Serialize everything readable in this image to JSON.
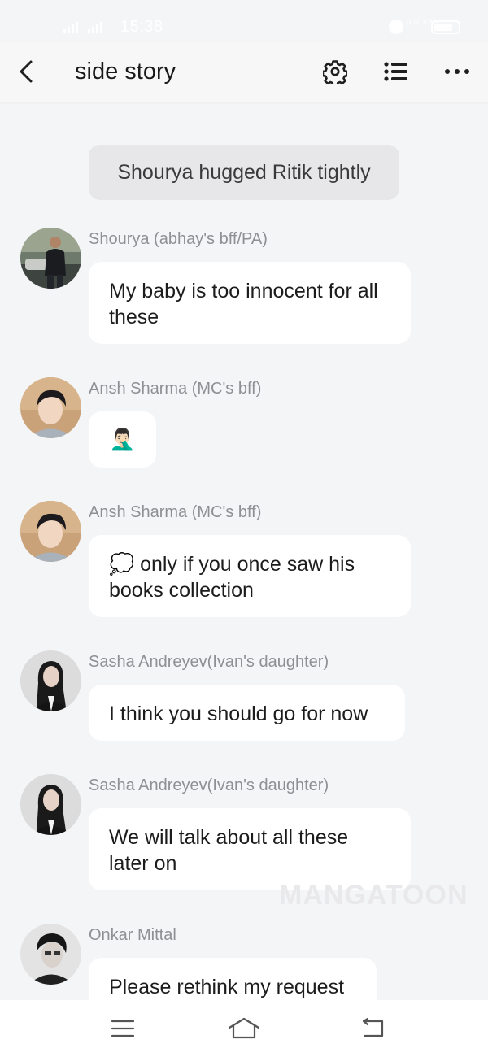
{
  "status_bar": {
    "time": "15:38",
    "network_speed": "0.20 KB/s",
    "battery": "59"
  },
  "header": {
    "title": "side story",
    "back_icon": "chevron-left-icon",
    "settings_icon": "gear-icon",
    "list_icon": "list-icon",
    "more_icon": "more-horizontal-icon"
  },
  "chat": {
    "narration": "Shourya hugged Ritik tightly",
    "messages": [
      {
        "sender": "Shourya (abhay's bff/PA)",
        "text": "My baby is too innocent for all these",
        "avatar": "avatar-shourya"
      },
      {
        "sender": "Ansh Sharma (MC's bff)",
        "text": "🤦🏻‍♂️",
        "avatar": "avatar-ansh"
      },
      {
        "sender": "Ansh Sharma (MC's bff)",
        "text": "💭 only if you once saw his books collection",
        "avatar": "avatar-ansh"
      },
      {
        "sender": "Sasha Andreyev(Ivan's daughter)",
        "text": "I think you should go for now",
        "avatar": "avatar-sasha"
      },
      {
        "sender": "Sasha Andreyev(Ivan's daughter)",
        "text": "We will talk about all these later on",
        "avatar": "avatar-sasha"
      },
      {
        "sender": "Onkar Mittal",
        "text": "Please rethink my request",
        "avatar": "avatar-onkar"
      }
    ],
    "watermark": "MANGATOON"
  },
  "nav_bar": {
    "menu_icon": "menu-icon",
    "home_icon": "home-icon",
    "back_icon": "back-icon"
  },
  "colors": {
    "background": "#f4f5f7",
    "bubble": "#ffffff",
    "narration_bubble": "#e7e7e9",
    "sender_text": "#8f8f94",
    "message_text": "#1c1c1c"
  }
}
